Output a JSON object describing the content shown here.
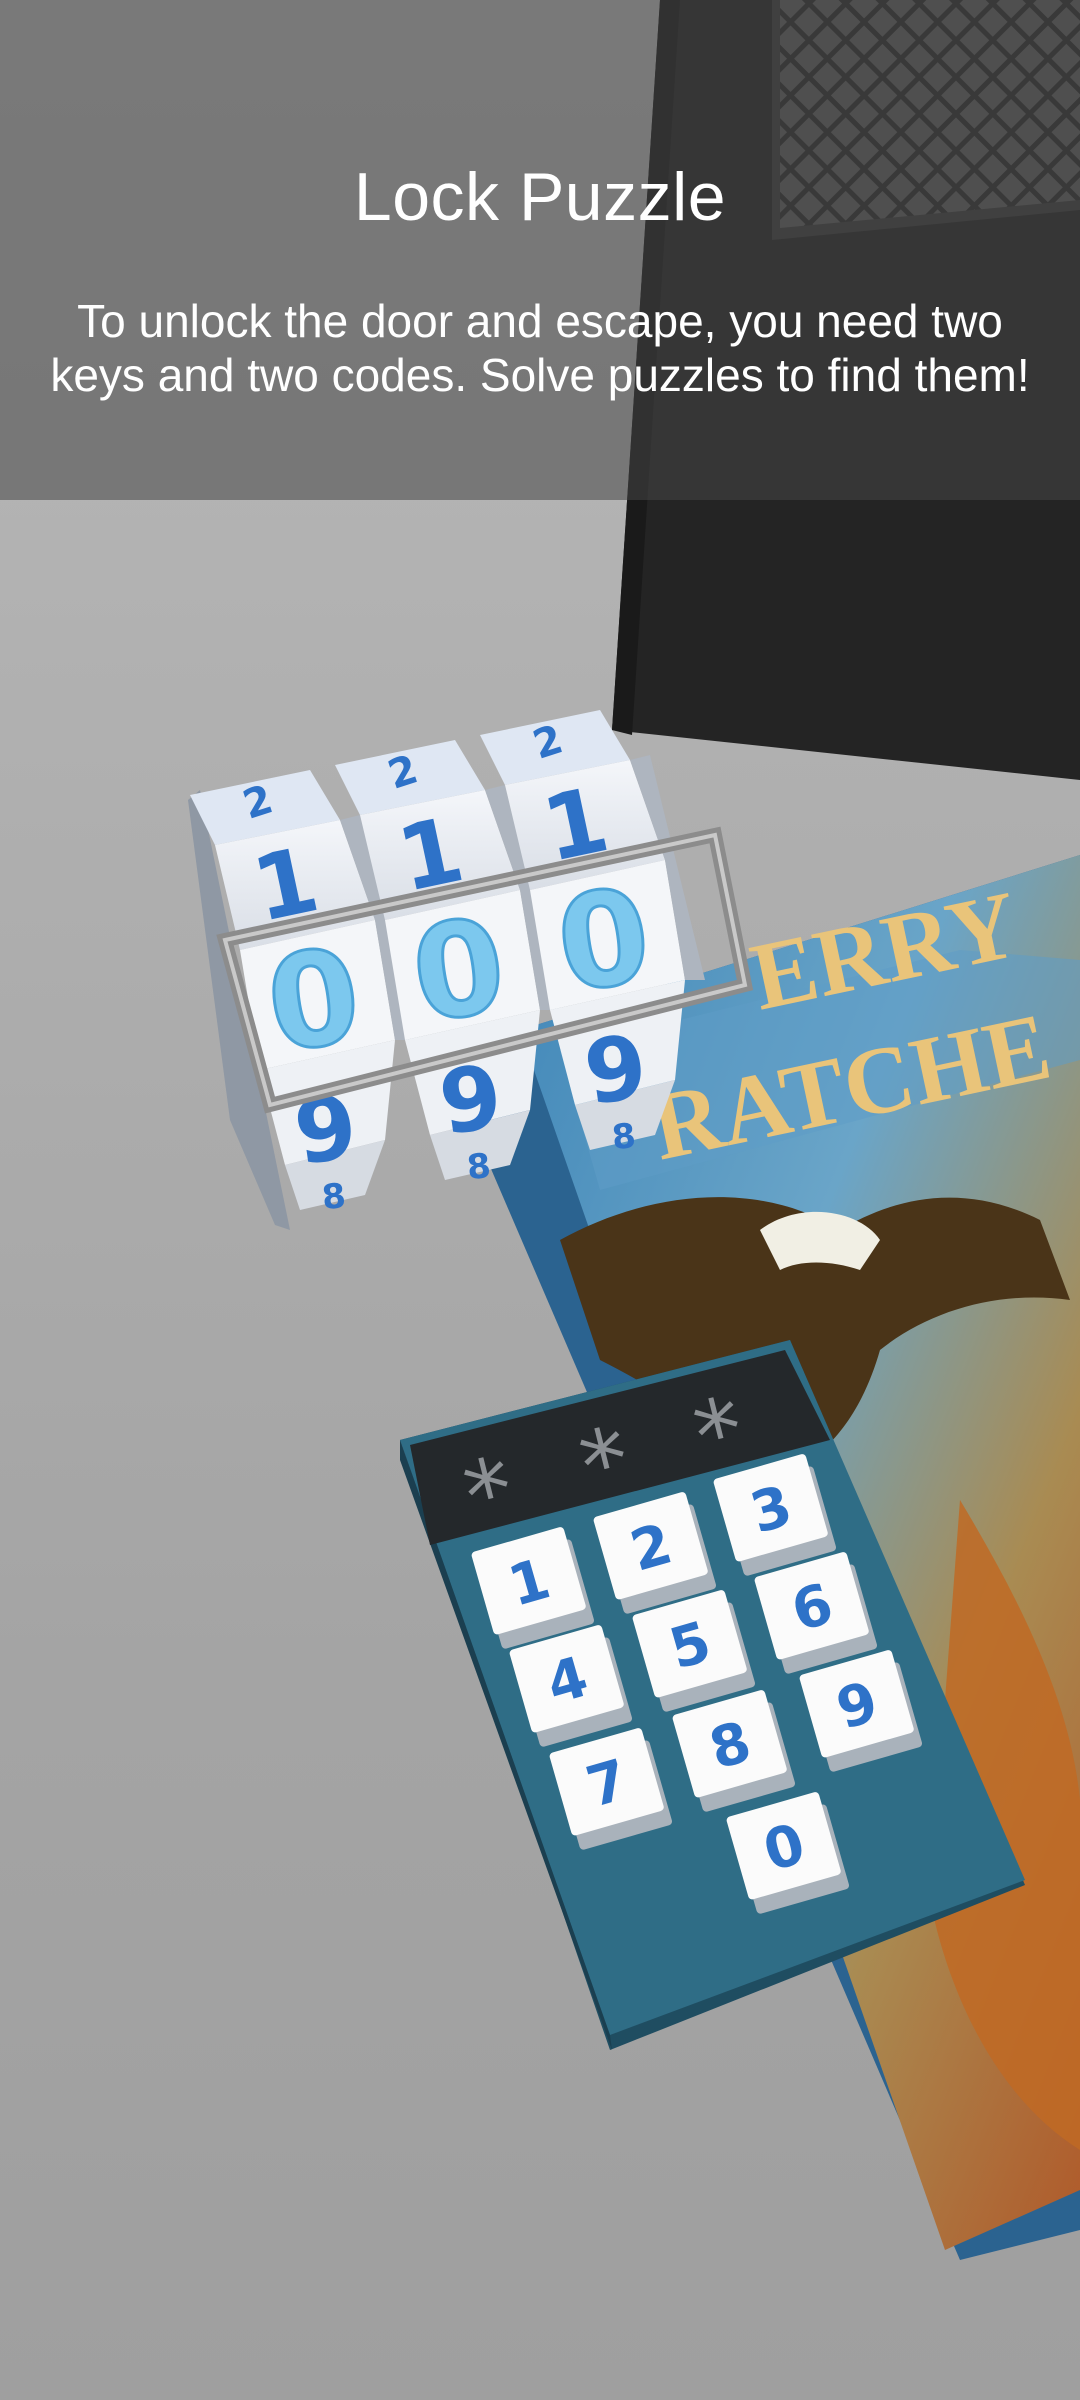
{
  "overlay": {
    "title": "Lock Puzzle",
    "description": "To unlock the door and escape, you need two keys and two codes. Solve puzzles to find them!"
  },
  "combination_lock": {
    "reels": [
      {
        "above2": "2",
        "above1": "1",
        "selected": "0",
        "below": "9",
        "below2": "8"
      },
      {
        "above2": "2",
        "above1": "1",
        "selected": "0",
        "below": "9",
        "below2": "8"
      },
      {
        "above2": "2",
        "above1": "1",
        "selected": "0",
        "below": "9",
        "below2": "8"
      }
    ]
  },
  "keypad": {
    "display": [
      "*",
      "*",
      "*"
    ],
    "keys": [
      "1",
      "2",
      "3",
      "4",
      "5",
      "6",
      "7",
      "8",
      "9",
      "0"
    ]
  },
  "book": {
    "cover_line1": "ERRY",
    "cover_line2": "RATCHE"
  },
  "colors": {
    "digit_blue": "#2e72c8",
    "selected_digit": "#7cc8ee",
    "keypad_body": "#2f6d86",
    "door": "#242424"
  }
}
